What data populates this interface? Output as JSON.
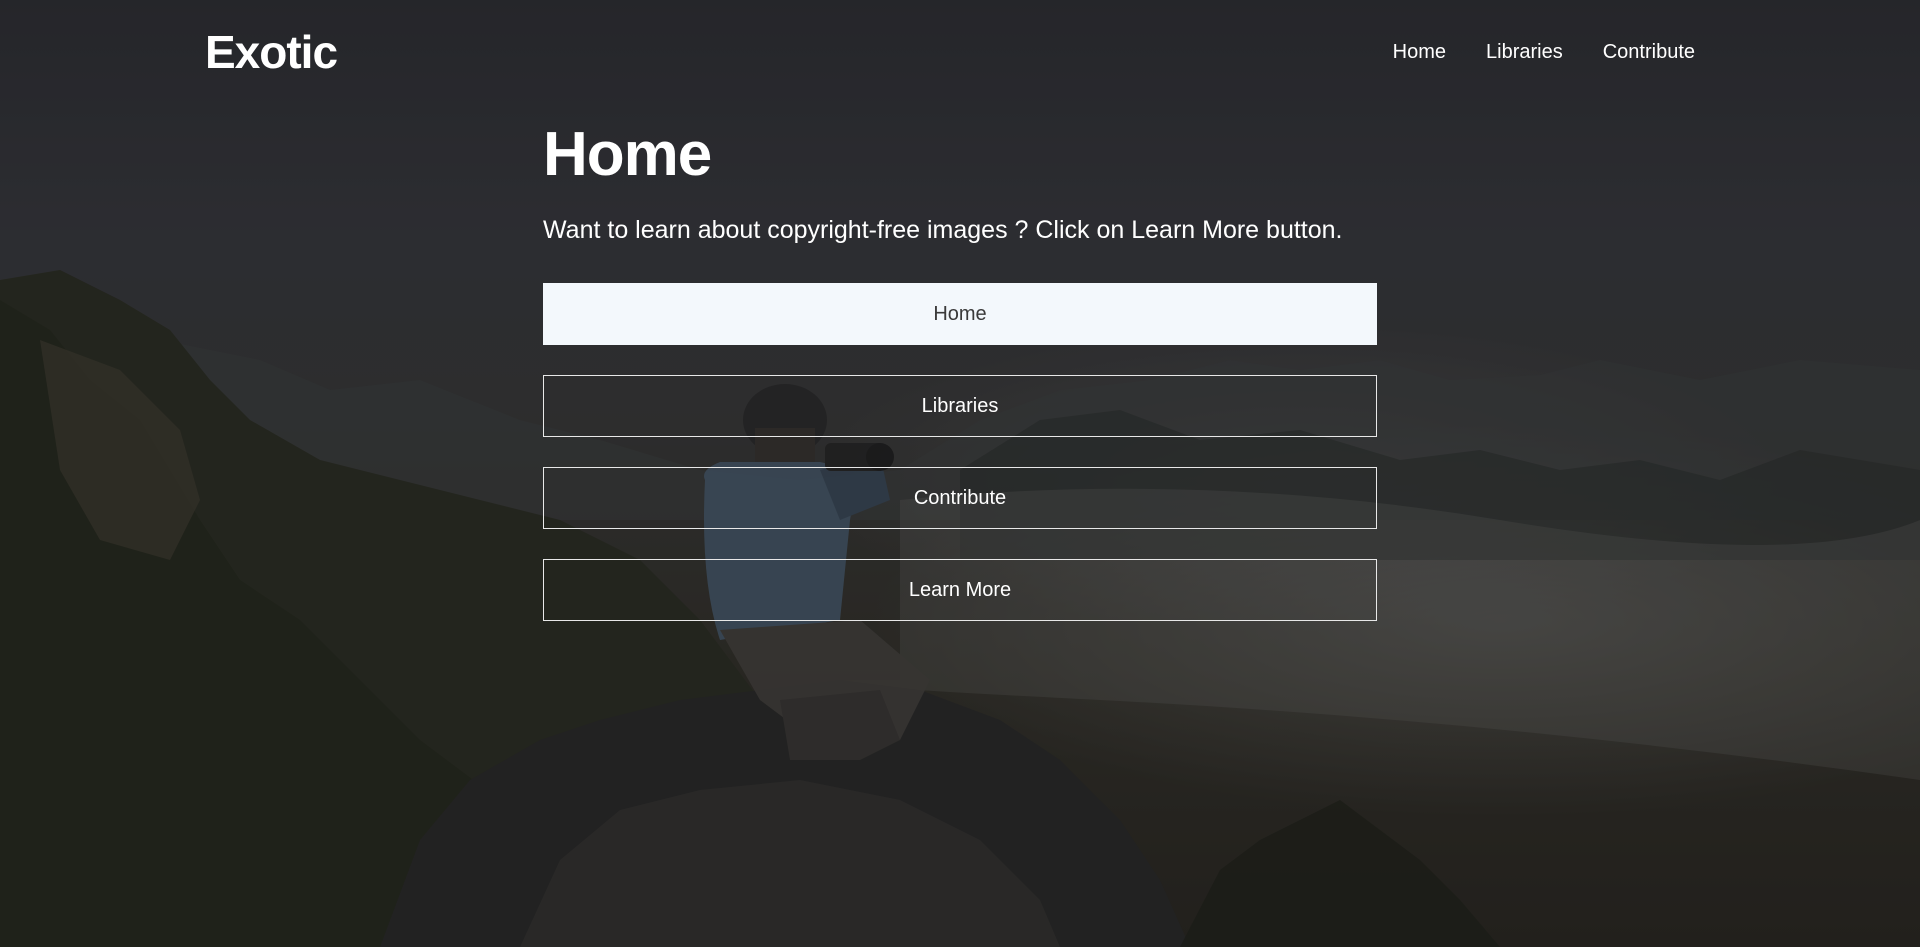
{
  "navbar": {
    "brand": "Exotic",
    "links": [
      {
        "label": "Home"
      },
      {
        "label": "Libraries"
      },
      {
        "label": "Contribute"
      }
    ]
  },
  "main": {
    "title": "Home",
    "lead": "Want to learn about copyright-free images ? Click on Learn More button.",
    "buttons": [
      {
        "label": "Home",
        "active": true
      },
      {
        "label": "Libraries",
        "active": false
      },
      {
        "label": "Contribute",
        "active": false
      },
      {
        "label": "Learn More",
        "active": false
      }
    ]
  },
  "colors": {
    "text": "#ffffff",
    "active_button_bg": "#f3f8fc",
    "active_button_text": "#3a3a3a",
    "button_border": "#e8e8e8"
  },
  "background": {
    "image_icon": "photographer-on-mountain-image"
  }
}
